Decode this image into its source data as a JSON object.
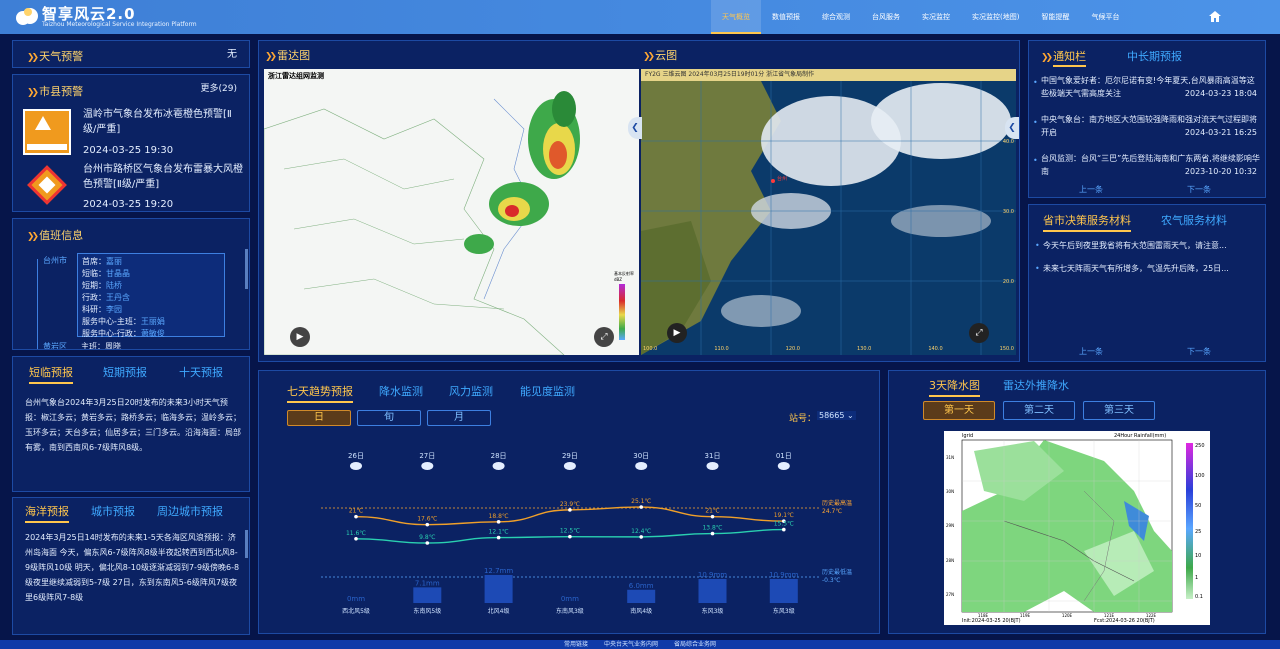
{
  "header": {
    "title": "智享风云2.0",
    "subtitle": "Taizhou Meteorological Service Integration Platform",
    "nav": [
      "天气概览",
      "数值预报",
      "综合观测",
      "台风服务",
      "实况监控",
      "实况监控(地图)",
      "智能提醒",
      "气候平台"
    ]
  },
  "warning": {
    "title": "天气预警",
    "status": "无"
  },
  "county": {
    "title": "市县预警",
    "more": "更多(29)",
    "items": [
      {
        "text": "温岭市气象台发布冰雹橙色预警[Ⅱ级/严重]",
        "time": "2024-03-25 19:30",
        "icon": "hail-warning-icon"
      },
      {
        "text": "台州市路桥区气象台发布雷暴大风橙色预警[Ⅱ级/严重]",
        "time": "2024-03-25 19:20",
        "icon": "thunder-wind-warning-icon"
      }
    ]
  },
  "duty": {
    "title": "值班信息",
    "org": "台州市",
    "org2": "黄岩区",
    "rows": [
      {
        "role": "首席",
        "name": "嘉丽"
      },
      {
        "role": "短临",
        "name": "甘晶晶"
      },
      {
        "role": "短期",
        "name": "陆桥"
      },
      {
        "role": "行政",
        "name": "王丹含"
      },
      {
        "role": "科研",
        "name": "李园"
      },
      {
        "role": "服务中心-主班",
        "name": "王丽娟"
      },
      {
        "role": "服务中心-行政",
        "name": "萧敏俊"
      }
    ],
    "bottom": "主班：周晓"
  },
  "shortfc": {
    "tabs": [
      "短临预报",
      "短期预报",
      "十天预报"
    ],
    "text": "台州气象台2024年3月25日20时发布的未来3小时天气预报：椒江多云；黄岩多云；路桥多云；临海多云；温岭多云；玉环多云；天台多云；仙居多云；三门多云。沿海海面：局部有雾，南到西南风6-7级阵风8级。"
  },
  "marine": {
    "tabs": [
      "海洋预报",
      "城市预报",
      "周边城市预报"
    ],
    "text": "2024年3月25日14时发布的未来1-5天各海区风浪预报：济州岛海面 今天，偏东风6-7级阵风8级半夜起转西到西北风8-9级阵风10级 明天，偏北风8-10级逐渐减弱到7-9级傍晚6-8级夜里继续减弱到5-7级 27日，东到东南风5-6级阵风7级夜里6级阵风7-8级"
  },
  "radar": {
    "title": "雷达图",
    "map_title": "浙江雷达组网监测",
    "legend_label": "基本反射率 dBZ"
  },
  "cloud": {
    "title": "云图",
    "caption": "FY2G 三维云图 2024年03月25日19时01分 浙江省气象局制作",
    "city": "台州",
    "lon": [
      "100.0",
      "110.0",
      "120.0",
      "130.0",
      "140.0",
      "150.0"
    ],
    "lat": [
      "40.0",
      "30.0",
      "20.0"
    ]
  },
  "notice": {
    "tabs": [
      "通知栏",
      "中长期预报"
    ],
    "items": [
      {
        "text": "中国气象爱好者：厄尔尼诺有变!今年夏天,台风暴雨高温等这些极端天气需高度关注",
        "time": "2024-03-23 18:04"
      },
      {
        "text": "中央气象台：南方地区大范围较强降雨和强对流天气过程即将开启",
        "time": "2024-03-21 16:25"
      },
      {
        "text": "台风监测：台风“三巴”先后登陆海南和广东两省,将继续影响华南",
        "time": "2023-10-20 10:32"
      }
    ],
    "prev": "上一条",
    "next": "下一条"
  },
  "decision": {
    "tabs": [
      "省市决策服务材料",
      "农气服务材料"
    ],
    "items": [
      "今天午后到夜里我省将有大范围雷雨天气，请注意...",
      "未来七天阵雨天气有所增多，气温先升后降，25日..."
    ],
    "prev": "上一条",
    "next": "下一条"
  },
  "trend": {
    "tabs": [
      "七天趋势预报",
      "降水监测",
      "风力监测",
      "能见度监测"
    ],
    "periods": [
      "日",
      "旬",
      "月"
    ],
    "station_label": "站号：",
    "station": "58665"
  },
  "rain": {
    "tabs": [
      "3天降水图",
      "雷达外推降水"
    ],
    "days": [
      "第一天",
      "第二天",
      "第三天"
    ],
    "map_title_left": "lgrid",
    "map_title_right": "24Hour Rainfall(mm)",
    "init": "Init:2024-03-25 20(BJT)",
    "fcst": "Fcst:2024-03-26 20(BJT)",
    "legend": [
      "250",
      "100",
      "50",
      "25",
      "10",
      "1",
      "0.1"
    ],
    "lon": [
      "118E",
      "119E",
      "120E",
      "121E",
      "122E"
    ],
    "lat": [
      "31N",
      "30N",
      "29N",
      "28N",
      "27N"
    ]
  },
  "chart_data": {
    "type": "line",
    "categories": [
      "26日",
      "27日",
      "28日",
      "29日",
      "30日",
      "31日",
      "01日"
    ],
    "series": [
      {
        "name": "最高温度",
        "values": [
          21,
          17.6,
          18.8,
          23.9,
          25.1,
          21,
          19.1
        ],
        "labels": [
          "21℃",
          "17.6℃",
          "18.8℃",
          "23.9℃",
          "25.1℃",
          "21℃",
          "19.1℃"
        ]
      },
      {
        "name": "最低温度",
        "values": [
          11.6,
          9.8,
          12.1,
          12.5,
          12.4,
          13.8,
          15.5
        ],
        "labels": [
          "11.6℃",
          "9.8℃",
          "12.1℃",
          "12.5℃",
          "12.4℃",
          "13.8℃",
          "15.5℃"
        ]
      }
    ],
    "rain": [
      0,
      7.1,
      12.7,
      0,
      6.0,
      10.9,
      10.9
    ],
    "rain_labels": [
      "0mm",
      "7.1mm",
      "12.7mm",
      "0mm",
      "6.0mm",
      "10.9mm",
      "10.9mm"
    ],
    "wind": [
      "西北风5级",
      "东南风5级",
      "北风4级",
      "东南风3级",
      "南风4级",
      "东风3级",
      "东风3级"
    ],
    "ref_high": {
      "label": "历史最高温",
      "value": "24.7℃",
      "v": 24.7
    },
    "ref_low": {
      "label": "历史最低温",
      "value": "-0.3℃",
      "v": -0.3
    }
  },
  "footer": [
    "常用链接",
    "中央台天气业务内网",
    "省局综合业务网"
  ]
}
